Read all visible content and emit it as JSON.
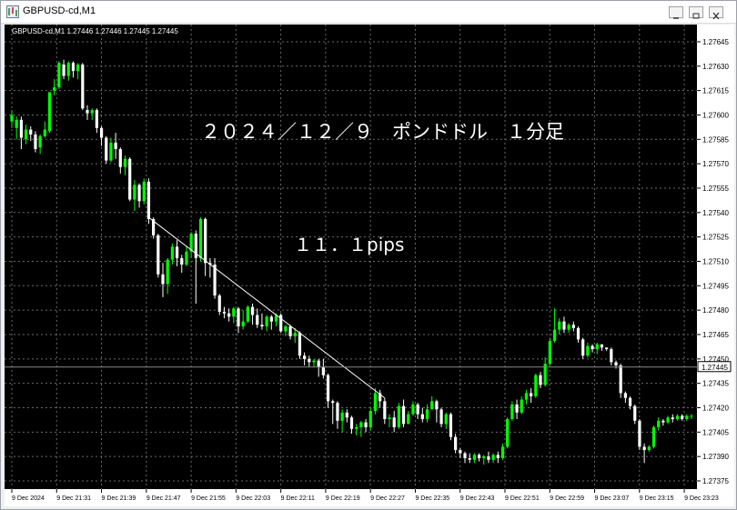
{
  "window": {
    "title": "GBPUSD-cd,M1"
  },
  "chart_header": {
    "text": "GBPUSD-cd,M1  1.27446 1.27446 1.27445 1.27445"
  },
  "annotations": {
    "title": "２０２４／１２／９　ポンドドル　１分足",
    "pips": "１１．１pips"
  },
  "colors": {
    "background": "#000000",
    "grid": "#6a6a6a",
    "bull": "#00ff00",
    "bear": "#ffffff",
    "axis_text": "#000000",
    "line": "#ffffff",
    "price_tag_bg": "#ffffff"
  },
  "chart_data": {
    "type": "candlestick",
    "symbol": "GBPUSD-cd",
    "timeframe": "M1",
    "ylim": [
      1.27375,
      1.2765
    ],
    "y_ticks": [
      "1.27645",
      "1.27630",
      "1.27615",
      "1.27600",
      "1.27585",
      "1.27570",
      "1.27555",
      "1.27540",
      "1.27525",
      "1.27510",
      "1.27495",
      "1.27480",
      "1.27465",
      "1.27450",
      "1.27435",
      "1.27420",
      "1.27405",
      "1.27390",
      "1.27375"
    ],
    "x_ticks": [
      "9 Dec 2024",
      "9 Dec 21:31",
      "9 Dec 21:39",
      "9 Dec 21:47",
      "9 Dec 21:55",
      "9 Dec 22:03",
      "9 Dec 22:11",
      "9 Dec 22:19",
      "9 Dec 22:27",
      "9 Dec 22:35",
      "9 Dec 22:43",
      "9 Dec 22:51",
      "9 Dec 22:59",
      "9 Dec 23:07",
      "9 Dec 23:15",
      "9 Dec 23:23"
    ],
    "current_price": "1.27445",
    "trend_line": {
      "from_index": 29,
      "from_price": 1.27537,
      "to_index": 79,
      "to_price": 1.27426,
      "label": "１１．１pips"
    },
    "candles": [
      [
        1.27596,
        1.276,
        1.27592,
        1.27603
      ],
      [
        1.27592,
        1.27597,
        1.27585,
        1.27599
      ],
      [
        1.27597,
        1.27586,
        1.27579,
        1.27599
      ],
      [
        1.27585,
        1.27591,
        1.27582,
        1.27594
      ],
      [
        1.27591,
        1.27588,
        1.27584,
        1.27593
      ],
      [
        1.27588,
        1.27579,
        1.27577,
        1.2759
      ],
      [
        1.2758,
        1.27587,
        1.27576,
        1.27588
      ],
      [
        1.27587,
        1.27591,
        1.27586,
        1.27596
      ],
      [
        1.2759,
        1.27614,
        1.27589,
        1.27614
      ],
      [
        1.27615,
        1.27617,
        1.27612,
        1.27622
      ],
      [
        1.27617,
        1.27632,
        1.27616,
        1.27633
      ],
      [
        1.27631,
        1.27624,
        1.27622,
        1.27634
      ],
      [
        1.27624,
        1.27632,
        1.27621,
        1.27633
      ],
      [
        1.27632,
        1.27627,
        1.27623,
        1.27633
      ],
      [
        1.27627,
        1.27631,
        1.27622,
        1.27632
      ],
      [
        1.27631,
        1.27604,
        1.27603,
        1.27632
      ],
      [
        1.27603,
        1.27601,
        1.27597,
        1.27606
      ],
      [
        1.27601,
        1.27603,
        1.27597,
        1.27604
      ],
      [
        1.27603,
        1.27592,
        1.27589,
        1.27604
      ],
      [
        1.27592,
        1.27586,
        1.27581,
        1.27593
      ],
      [
        1.27586,
        1.27572,
        1.2757,
        1.27587
      ],
      [
        1.27572,
        1.27583,
        1.27571,
        1.27586
      ],
      [
        1.27583,
        1.27579,
        1.27573,
        1.27589
      ],
      [
        1.27579,
        1.27568,
        1.27564,
        1.2758
      ],
      [
        1.27568,
        1.27573,
        1.27563,
        1.27575
      ],
      [
        1.27573,
        1.27548,
        1.27547,
        1.27574
      ],
      [
        1.27548,
        1.27557,
        1.27541,
        1.2756
      ],
      [
        1.27557,
        1.27547,
        1.27543,
        1.27558
      ],
      [
        1.27547,
        1.27559,
        1.27545,
        1.27561
      ],
      [
        1.27559,
        1.27536,
        1.27533,
        1.27561
      ],
      [
        1.27536,
        1.27526,
        1.27524,
        1.27537
      ],
      [
        1.27526,
        1.27502,
        1.275,
        1.27527
      ],
      [
        1.27502,
        1.27496,
        1.27488,
        1.27509
      ],
      [
        1.27496,
        1.27511,
        1.2749,
        1.27512
      ],
      [
        1.27511,
        1.27519,
        1.27508,
        1.27521
      ],
      [
        1.27519,
        1.27512,
        1.27507,
        1.27523
      ],
      [
        1.27512,
        1.27508,
        1.27503,
        1.27514
      ],
      [
        1.27508,
        1.27516,
        1.27507,
        1.27519
      ],
      [
        1.27516,
        1.27527,
        1.27512,
        1.27528
      ],
      [
        1.27527,
        1.27512,
        1.27484,
        1.27529
      ],
      [
        1.27512,
        1.27536,
        1.2751,
        1.27537
      ],
      [
        1.27536,
        1.27509,
        1.27501,
        1.27537
      ],
      [
        1.27509,
        1.27508,
        1.275,
        1.27512
      ],
      [
        1.27508,
        1.27489,
        1.27487,
        1.27512
      ],
      [
        1.27489,
        1.27479,
        1.27477,
        1.2749
      ],
      [
        1.27479,
        1.27478,
        1.27475,
        1.27482
      ],
      [
        1.27478,
        1.27476,
        1.27473,
        1.27481
      ],
      [
        1.27476,
        1.27481,
        1.27472,
        1.27482
      ],
      [
        1.27481,
        1.2747,
        1.27466,
        1.27482
      ],
      [
        1.2747,
        1.27473,
        1.27468,
        1.2748
      ],
      [
        1.27473,
        1.27482,
        1.27472,
        1.27483
      ],
      [
        1.27482,
        1.27477,
        1.27471,
        1.27484
      ],
      [
        1.27477,
        1.27471,
        1.27469,
        1.27481
      ],
      [
        1.27471,
        1.2747,
        1.27468,
        1.27478
      ],
      [
        1.2747,
        1.27476,
        1.27467,
        1.27477
      ],
      [
        1.27476,
        1.27473,
        1.27468,
        1.27477
      ],
      [
        1.27473,
        1.27477,
        1.2747,
        1.27478
      ],
      [
        1.27477,
        1.27467,
        1.27466,
        1.27478
      ],
      [
        1.27467,
        1.2747,
        1.27464,
        1.27471
      ],
      [
        1.2747,
        1.27464,
        1.27462,
        1.27471
      ],
      [
        1.27464,
        1.27466,
        1.2746,
        1.27469
      ],
      [
        1.27466,
        1.27452,
        1.2745,
        1.27467
      ],
      [
        1.27452,
        1.2745,
        1.27446,
        1.27454
      ],
      [
        1.2745,
        1.27448,
        1.27445,
        1.27452
      ],
      [
        1.27448,
        1.27449,
        1.27445,
        1.2745
      ],
      [
        1.27449,
        1.27445,
        1.27439,
        1.2745
      ],
      [
        1.27445,
        1.2744,
        1.27438,
        1.2745
      ],
      [
        1.2744,
        1.27424,
        1.2742,
        1.27441
      ],
      [
        1.27424,
        1.27423,
        1.2741,
        1.27425
      ],
      [
        1.27423,
        1.27412,
        1.27407,
        1.27424
      ],
      [
        1.27412,
        1.27417,
        1.27405,
        1.27419
      ],
      [
        1.27417,
        1.27414,
        1.27411,
        1.27419
      ],
      [
        1.27414,
        1.27407,
        1.27404,
        1.27415
      ],
      [
        1.27407,
        1.27408,
        1.27403,
        1.2741
      ],
      [
        1.27408,
        1.27411,
        1.27402,
        1.27412
      ],
      [
        1.27411,
        1.27408,
        1.27405,
        1.27413
      ],
      [
        1.27408,
        1.27418,
        1.27406,
        1.2742
      ],
      [
        1.27418,
        1.27429,
        1.27416,
        1.27432
      ],
      [
        1.27429,
        1.27424,
        1.2742,
        1.27431
      ],
      [
        1.27424,
        1.27413,
        1.2741,
        1.27426
      ],
      [
        1.27413,
        1.27414,
        1.27408,
        1.27416
      ],
      [
        1.27414,
        1.27408,
        1.27405,
        1.27418
      ],
      [
        1.27408,
        1.27421,
        1.27407,
        1.27423
      ],
      [
        1.27421,
        1.2741,
        1.27408,
        1.27425
      ],
      [
        1.2741,
        1.27416,
        1.2741,
        1.27418
      ],
      [
        1.27416,
        1.27422,
        1.27415,
        1.27424
      ],
      [
        1.27422,
        1.27416,
        1.27413,
        1.27423
      ],
      [
        1.27416,
        1.27413,
        1.27411,
        1.2742
      ],
      [
        1.27413,
        1.27419,
        1.27411,
        1.27422
      ],
      [
        1.27419,
        1.27424,
        1.27419,
        1.27427
      ],
      [
        1.27424,
        1.27419,
        1.27411,
        1.27425
      ],
      [
        1.27419,
        1.2741,
        1.27408,
        1.2742
      ],
      [
        1.2741,
        1.27416,
        1.27407,
        1.27417
      ],
      [
        1.27416,
        1.27402,
        1.274,
        1.27417
      ],
      [
        1.27402,
        1.27394,
        1.27392,
        1.27404
      ],
      [
        1.27394,
        1.27392,
        1.27389,
        1.27395
      ],
      [
        1.27392,
        1.27389,
        1.27386,
        1.27393
      ],
      [
        1.27389,
        1.27388,
        1.27386,
        1.27392
      ],
      [
        1.27388,
        1.27391,
        1.27386,
        1.27392
      ],
      [
        1.27391,
        1.27389,
        1.27387,
        1.27392
      ],
      [
        1.27389,
        1.2739,
        1.27385,
        1.27391
      ],
      [
        1.2739,
        1.27388,
        1.27386,
        1.27393
      ],
      [
        1.27388,
        1.27391,
        1.27386,
        1.27392
      ],
      [
        1.27391,
        1.27389,
        1.27386,
        1.27393
      ],
      [
        1.27389,
        1.27396,
        1.27388,
        1.27398
      ],
      [
        1.27396,
        1.27413,
        1.27395,
        1.27414
      ],
      [
        1.27413,
        1.27422,
        1.27412,
        1.27424
      ],
      [
        1.27422,
        1.27417,
        1.27413,
        1.27425
      ],
      [
        1.27417,
        1.27425,
        1.27416,
        1.27427
      ],
      [
        1.27425,
        1.27429,
        1.27422,
        1.27431
      ],
      [
        1.27429,
        1.27427,
        1.27423,
        1.27432
      ],
      [
        1.27427,
        1.2744,
        1.27426,
        1.27441
      ],
      [
        1.2744,
        1.27434,
        1.27432,
        1.27442
      ],
      [
        1.27434,
        1.27447,
        1.27433,
        1.27451
      ],
      [
        1.27447,
        1.27461,
        1.27446,
        1.27463
      ],
      [
        1.27461,
        1.27468,
        1.2746,
        1.27481
      ],
      [
        1.27468,
        1.27473,
        1.27465,
        1.27475
      ],
      [
        1.27473,
        1.27468,
        1.27466,
        1.27476
      ],
      [
        1.27468,
        1.27471,
        1.27466,
        1.27472
      ],
      [
        1.27471,
        1.27469,
        1.27467,
        1.27473
      ],
      [
        1.27469,
        1.27462,
        1.2746,
        1.2747
      ],
      [
        1.27462,
        1.27452,
        1.2745,
        1.27463
      ],
      [
        1.27452,
        1.27458,
        1.27451,
        1.2746
      ],
      [
        1.27458,
        1.27456,
        1.27454,
        1.27459
      ],
      [
        1.27456,
        1.27459,
        1.27453,
        1.2746
      ],
      [
        1.27459,
        1.27457,
        1.27455,
        1.27458
      ],
      [
        1.27457,
        1.27456,
        1.27455,
        1.27457
      ],
      [
        1.27456,
        1.27448,
        1.27446,
        1.27457
      ],
      [
        1.27448,
        1.27446,
        1.27444,
        1.27449
      ],
      [
        1.27446,
        1.27429,
        1.27426,
        1.27447
      ],
      [
        1.27429,
        1.27426,
        1.27423,
        1.2743
      ],
      [
        1.27426,
        1.27421,
        1.27419,
        1.27427
      ],
      [
        1.27421,
        1.27412,
        1.2741,
        1.27422
      ],
      [
        1.27412,
        1.27396,
        1.27394,
        1.27413
      ],
      [
        1.27396,
        1.27394,
        1.27386,
        1.27398
      ],
      [
        1.27394,
        1.27396,
        1.27393,
        1.27397
      ],
      [
        1.27396,
        1.27408,
        1.27395,
        1.27409
      ],
      [
        1.27408,
        1.27412,
        1.27406,
        1.27414
      ],
      [
        1.27412,
        1.27411,
        1.27409,
        1.27413
      ],
      [
        1.27411,
        1.27414,
        1.2741,
        1.27415
      ],
      [
        1.27414,
        1.27413,
        1.27411,
        1.27416
      ],
      [
        1.27413,
        1.27415,
        1.27412,
        1.27416
      ],
      [
        1.27415,
        1.27413,
        1.27412,
        1.27416
      ],
      [
        1.27413,
        1.27415,
        1.27412,
        1.27416
      ],
      [
        1.27415,
        1.27415,
        1.27413,
        1.27416
      ]
    ]
  }
}
